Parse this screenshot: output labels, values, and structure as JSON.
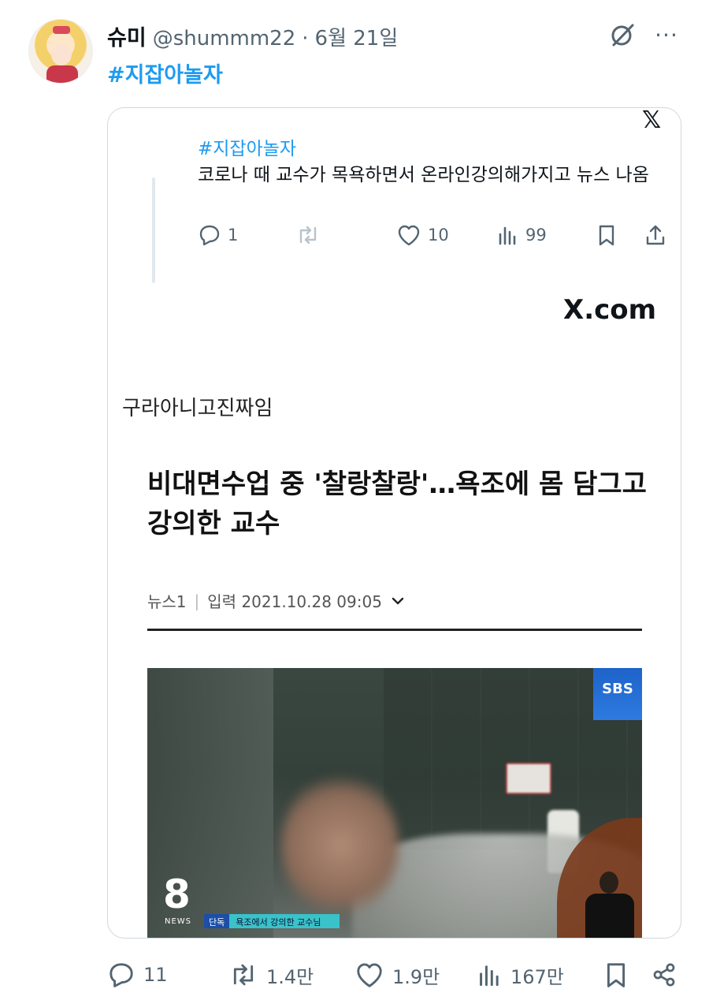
{
  "tweet": {
    "author_name": "슈미",
    "handle": "@shummm22",
    "separator": "·",
    "date": "6월 21일",
    "hashtag": "#지잡아놀자",
    "icons": {
      "grok": "grok-icon",
      "more": "more-icon"
    },
    "more_label": "···"
  },
  "quote": {
    "hashtag": "#지잡아놀자",
    "text": "코로나 때 교수가 목욕하면서 온라인강의해가지고 뉴스 나옴",
    "replies": "1",
    "retweets": "",
    "likes": "10",
    "views": "99",
    "source": "X.com"
  },
  "article": {
    "caption": "구라아니고진짜임",
    "headline": "비대면수업 중 '찰랑찰랑'…욕조에 몸 담그고 강의한 교수",
    "outlet": "뉴스1",
    "divider": "|",
    "input_date": "입력 2021.10.28 09:05",
    "image": {
      "broadcaster": "SBS",
      "channel_number": "8",
      "channel_label": "NEWS",
      "tag": "단독",
      "subtitle": "욕조에서 강의한 교수님"
    }
  },
  "actions": {
    "replies": "11",
    "retweets": "1.4만",
    "likes": "1.9만",
    "views": "167만"
  },
  "colors": {
    "accent": "#1d9bf0",
    "text": "#0f1419",
    "secondary": "#536471",
    "border": "#cfd9de"
  }
}
